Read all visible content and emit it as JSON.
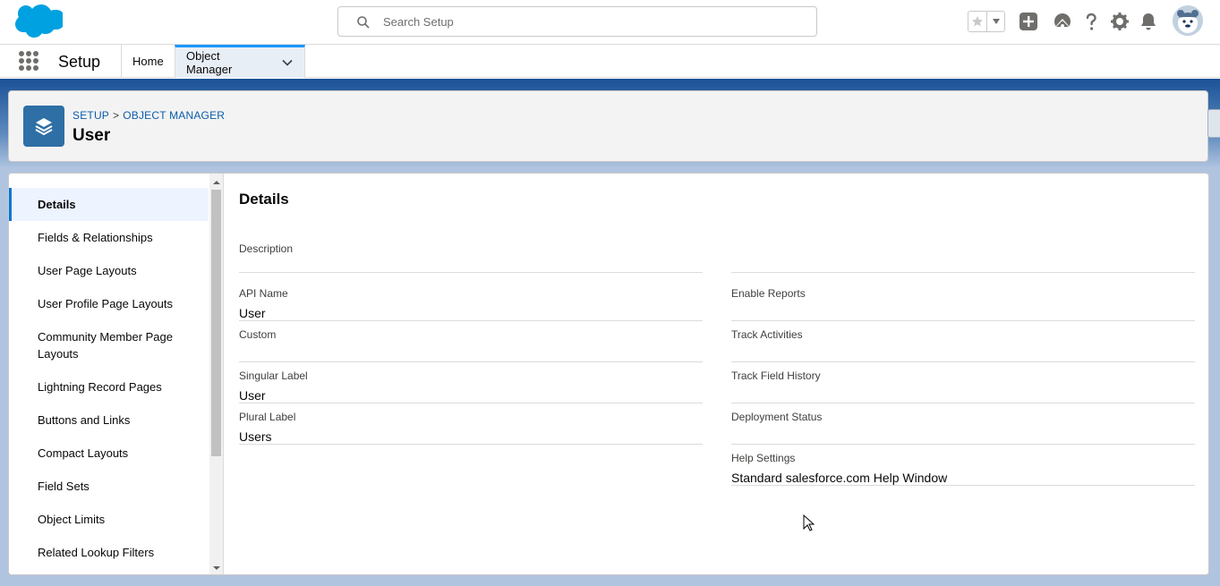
{
  "header": {
    "search_placeholder": "Search Setup",
    "icons": [
      "favorites-star-icon",
      "favorites-dropdown-icon",
      "global-actions-add-icon",
      "trailhead-icon",
      "help-icon",
      "setup-gear-icon",
      "notifications-bell-icon"
    ]
  },
  "nav": {
    "app_name": "Setup",
    "tabs": [
      {
        "label": "Home"
      },
      {
        "label": "Object Manager"
      }
    ]
  },
  "page_header": {
    "breadcrumb": [
      "SETUP",
      "OBJECT MANAGER"
    ],
    "breadcrumb_sep": ">",
    "title": "User"
  },
  "sidebar": {
    "items": [
      {
        "label": "Details"
      },
      {
        "label": "Fields & Relationships"
      },
      {
        "label": "User Page Layouts"
      },
      {
        "label": "User Profile Page Layouts"
      },
      {
        "label": "Community Member Page Layouts"
      },
      {
        "label": "Lightning Record Pages"
      },
      {
        "label": "Buttons and Links"
      },
      {
        "label": "Compact Layouts"
      },
      {
        "label": "Field Sets"
      },
      {
        "label": "Object Limits"
      },
      {
        "label": "Related Lookup Filters"
      }
    ]
  },
  "details": {
    "title": "Details",
    "left": [
      {
        "label": "Description",
        "value": ""
      },
      {
        "label": "API Name",
        "value": "User"
      },
      {
        "label": "Custom",
        "value": ""
      },
      {
        "label": "Singular Label",
        "value": "User"
      },
      {
        "label": "Plural Label",
        "value": "Users"
      }
    ],
    "right": [
      {
        "label": "",
        "value": ""
      },
      {
        "label": "Enable Reports",
        "value": ""
      },
      {
        "label": "Track Activities",
        "value": ""
      },
      {
        "label": "Track Field History",
        "value": ""
      },
      {
        "label": "Deployment Status",
        "value": ""
      },
      {
        "label": "Help Settings",
        "value": "Standard salesforce.com Help Window"
      }
    ]
  },
  "colors": {
    "brand": "#00a1e0",
    "accent": "#0176d3",
    "object_icon": "#2e6fa6"
  }
}
